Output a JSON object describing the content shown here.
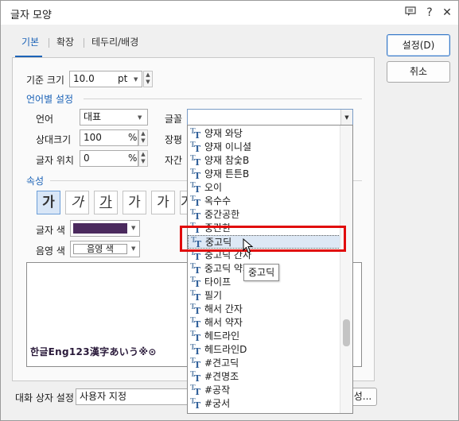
{
  "window": {
    "title": "글자 모양"
  },
  "titlebar": {
    "help_icon": "?",
    "close_icon": "✕"
  },
  "tabs": [
    {
      "label": "기본"
    },
    {
      "label": "확장"
    },
    {
      "label": "테두리/배경"
    }
  ],
  "buttons": {
    "ok": "설정(D)",
    "cancel": "취소"
  },
  "base_size": {
    "label": "기준 크기",
    "value": "10.0",
    "unit": "pt"
  },
  "lang_section": {
    "title": "언어별 설정",
    "language": {
      "label": "언어",
      "value": "대표"
    },
    "font": {
      "label": "글꼴",
      "value": ""
    },
    "relative_size": {
      "label": "상대크기",
      "value": "100",
      "unit": "%"
    },
    "spacing_label": "장평",
    "position": {
      "label": "글자 위치",
      "value": "0",
      "unit": "%"
    },
    "kerning_label": "자간"
  },
  "attr_section": {
    "title": "속성",
    "format_buttons": [
      "가",
      "가",
      "가",
      "가",
      "가",
      "가"
    ],
    "text_color": {
      "label": "글자 색"
    },
    "shade_color": {
      "label": "음영 색",
      "value": "음영 색"
    }
  },
  "colors": {
    "accent": "#1c63b7",
    "text_color": "#4b2a5e",
    "highlight": "#e10b0b"
  },
  "preview": {
    "text": "한글Eng123漢字あいう※⊙"
  },
  "font_list": {
    "items": [
      "양재 와당",
      "양재 이니셜",
      "양재 참숯B",
      "양재 튼튼B",
      "오이",
      "옥수수",
      "중간공한",
      "중간한",
      "중고딕",
      "중고딕 간자",
      "중고딕 약자",
      "타이프",
      "필기",
      "해서 간자",
      "해서 약자",
      "헤드라인",
      "헤드라인D",
      "#견고딕",
      "#견명조",
      "#공작",
      "#궁서"
    ],
    "selected_index": 8,
    "tooltip": "중고딕"
  },
  "bottom": {
    "label": "대화 상자 설정",
    "value": "사용자 지정",
    "more_label": "성..."
  }
}
